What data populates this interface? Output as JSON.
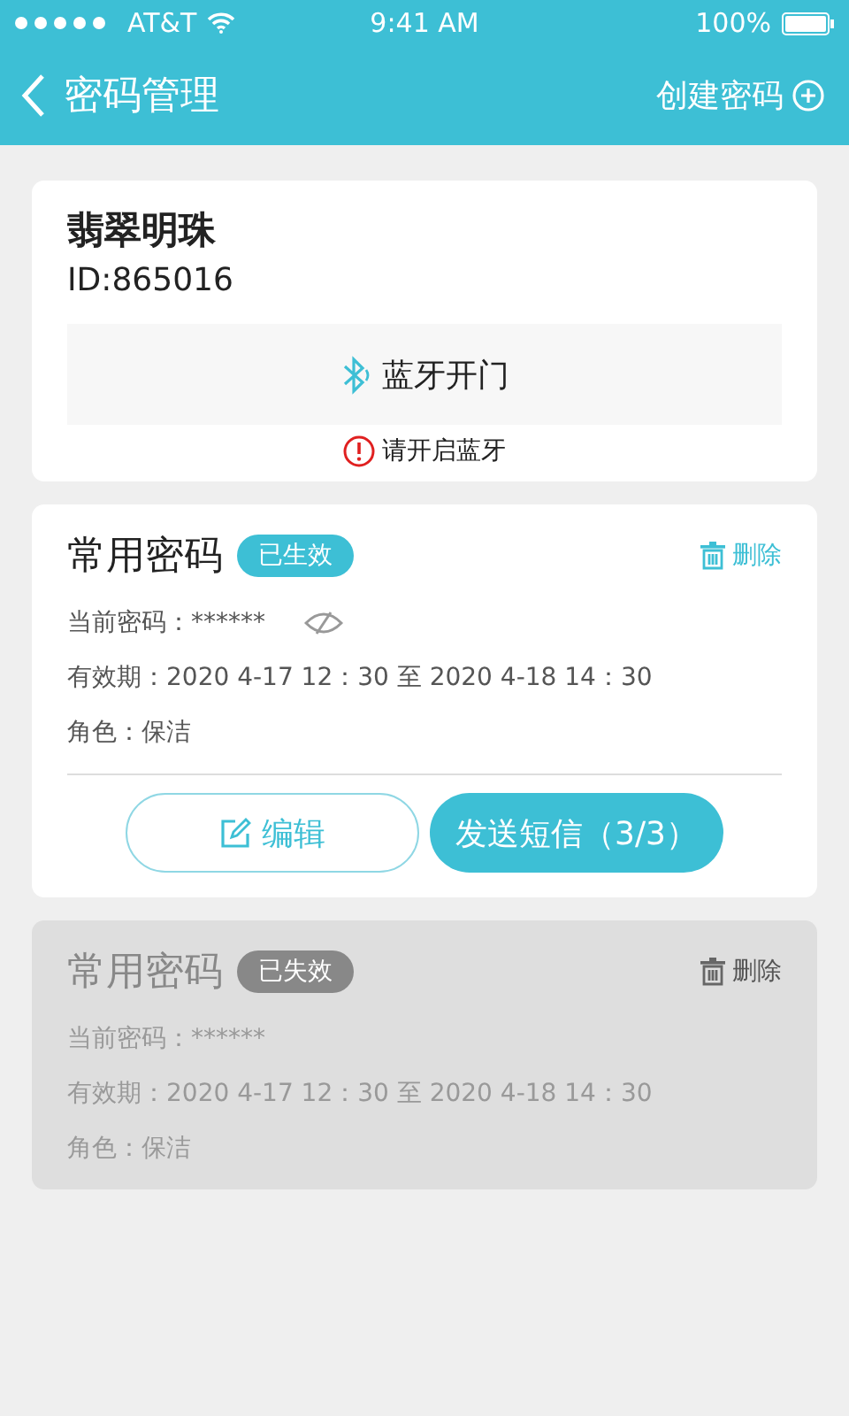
{
  "status_bar": {
    "carrier": "AT&T",
    "time": "9:41 AM",
    "battery": "100%"
  },
  "nav": {
    "title": "密码管理",
    "action": "创建密码"
  },
  "lock": {
    "name": "翡翠明珠",
    "id": "ID:865016",
    "unlock_button": "蓝牙开门",
    "warning": "请开启蓝牙"
  },
  "passwords": [
    {
      "title": "常用密码",
      "badge": "已生效",
      "active": true,
      "delete": "删除",
      "rows": [
        "当前密码：******",
        "有效期：2020 4-17 12：30 至 2020 4-18 14：30",
        "角色：保洁"
      ],
      "buttons": [
        "编辑",
        "发送短信（3/3）"
      ]
    },
    {
      "title": "常用密码",
      "badge": "已失效",
      "active": false,
      "delete": "删除",
      "rows": [
        "当前密码：******",
        "有效期：2020 4-17 12：30 至 2020 4-18 14：30",
        "角色：保洁"
      ]
    }
  ]
}
